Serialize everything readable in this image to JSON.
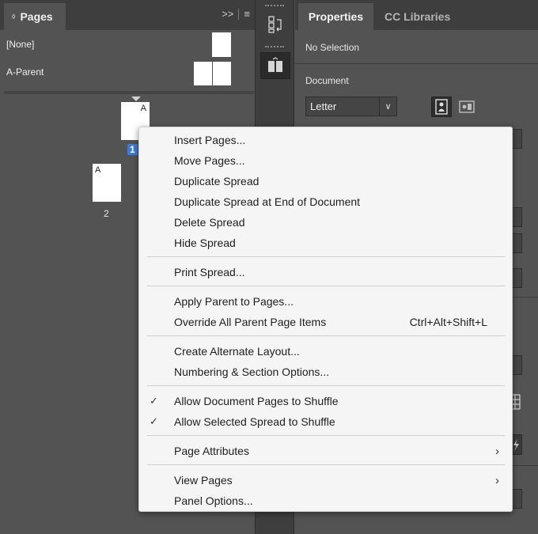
{
  "pages_panel": {
    "tab_label": "Pages",
    "tab_icon": "updown-arrows-icon",
    "parents": [
      {
        "label": "[None]"
      },
      {
        "label": "A-Parent"
      }
    ],
    "pages": [
      {
        "prefix": "A",
        "number": "1",
        "selected": true
      },
      {
        "prefix": "A",
        "number": "2",
        "selected": false
      }
    ]
  },
  "properties_panel": {
    "tabs": [
      {
        "label": "Properties",
        "active": true
      },
      {
        "label": "CC Libraries",
        "active": false
      }
    ],
    "selection_label": "No Selection",
    "document_label": "Document",
    "page_size": "Letter"
  },
  "context_menu": {
    "items": [
      {
        "label": "Insert Pages..."
      },
      {
        "label": "Move Pages..."
      },
      {
        "label": "Duplicate Spread"
      },
      {
        "label": "Duplicate Spread at End of Document"
      },
      {
        "label": "Delete Spread"
      },
      {
        "label": "Hide Spread"
      },
      {
        "label": "Print Spread..."
      },
      {
        "label": "Apply Parent to Pages..."
      },
      {
        "label": "Override All Parent Page Items",
        "shortcut": "Ctrl+Alt+Shift+L"
      },
      {
        "label": "Create Alternate Layout..."
      },
      {
        "label": "Numbering & Section Options..."
      },
      {
        "label": "Allow Document Pages to Shuffle",
        "checked": true,
        "check_glyph": "✓"
      },
      {
        "label": "Allow Selected Spread to Shuffle",
        "checked": true,
        "check_glyph": "✓"
      },
      {
        "label": "Page Attributes",
        "submenu": true,
        "chevron": "›"
      },
      {
        "label": "View Pages",
        "submenu": true,
        "chevron": "›"
      },
      {
        "label": "Panel Options..."
      }
    ]
  }
}
